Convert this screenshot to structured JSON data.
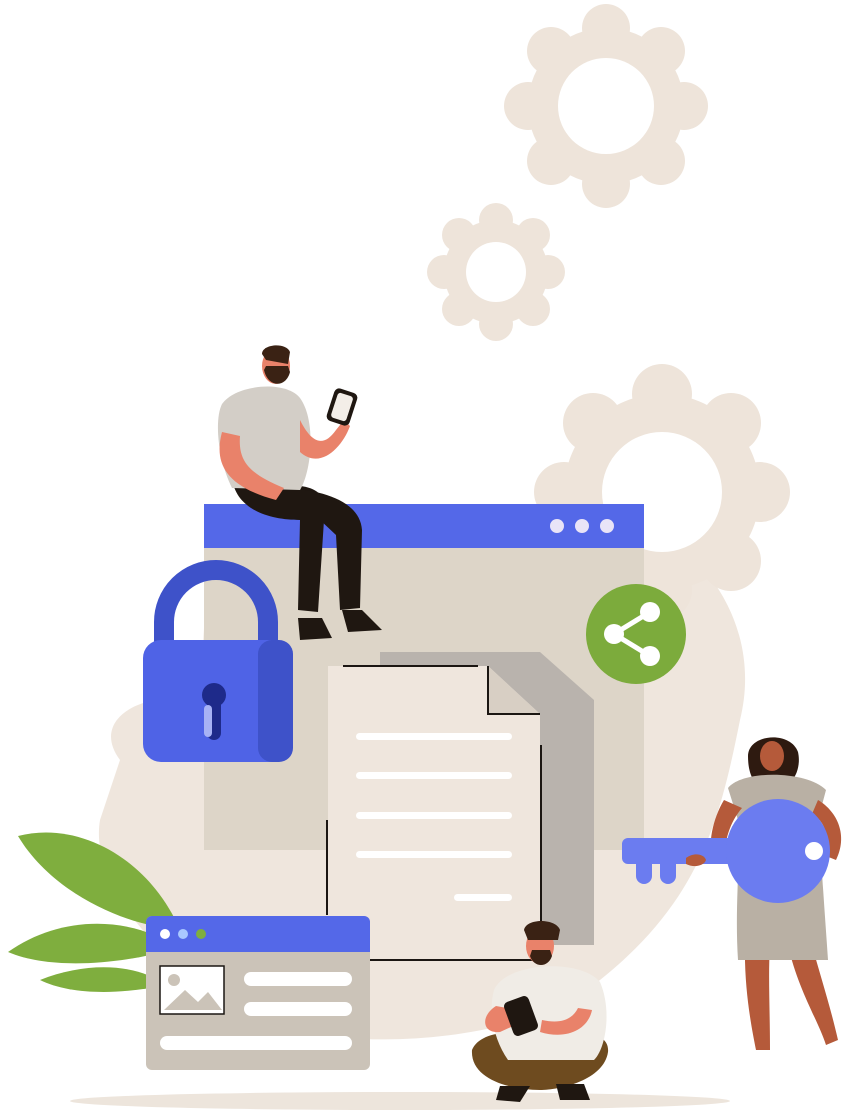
{
  "illustration": {
    "colors": {
      "background": "#ffffff",
      "beige": "#efe6dd",
      "gear": "#eee4da",
      "window_body": "#ddd5c8",
      "window_bar": "#5468e8",
      "lock": "#4f63e6",
      "lock_shade": "#3e52c9",
      "share_badge": "#7cab3c",
      "document": "#efe6dd",
      "document_shadow": "#b9b3ad",
      "key": "#6b7cf0",
      "leaf": "#7fae3e",
      "skin_light": "#e9826a",
      "skin_dark": "#b55a3a",
      "shirt_gray": "#d3cec7",
      "pants_black": "#1f1711",
      "pants_brown": "#6e4b1f",
      "hair_dark": "#3a2214"
    },
    "icons": [
      "gear-icon",
      "lock-icon",
      "keyhole-icon",
      "share-icon",
      "key-icon",
      "image-icon",
      "phone-icon"
    ]
  }
}
